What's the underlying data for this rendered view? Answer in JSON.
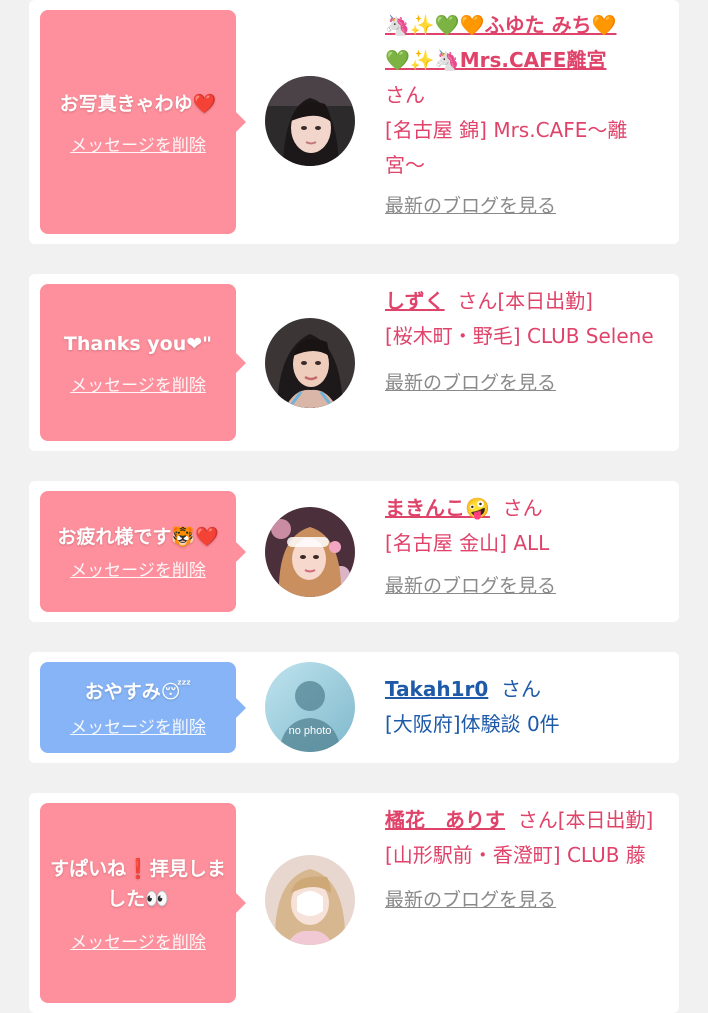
{
  "messages": [
    {
      "message": "お写真きゃわゆ❤️",
      "delete_label": "メッセージを削除",
      "name_line1": "🦄✨💚🧡ふゆた みち🧡",
      "name_line2": "💚✨🦄Mrs.CAFE離宮",
      "san": "さん",
      "shop": "[名古屋 錦] Mrs.CAFE〜離宮〜",
      "blog_label": "最新のブログを見る"
    },
    {
      "message": "Thanks you❤\"",
      "delete_label": "メッセージを削除",
      "name": "しずく",
      "san": "さん[本日出勤]",
      "shop": "[桜木町・野毛] CLUB Selene",
      "blog_label": "最新のブログを見る"
    },
    {
      "message": "お疲れ様です🐯❤️",
      "delete_label": "メッセージを削除",
      "name": "まきんこ🤪",
      "san": "さん",
      "shop": "[名古屋 金山] ALL",
      "blog_label": "最新のブログを見る"
    },
    {
      "message": "おやすみ😴",
      "delete_label": "メッセージを削除",
      "avatar_text": "no photo",
      "name": "Takah1r0",
      "san": "さん",
      "shop": "[大阪府]体験談 0件"
    },
    {
      "message": "すぱいね❗️拝見しました👀",
      "delete_label": "メッセージを削除",
      "name": "橘花　ありす",
      "san": "さん[本日出勤]",
      "shop": "[山形駅前・香澄町] CLUB 藤",
      "blog_label": "最新のブログを見る"
    }
  ],
  "colors": {
    "bubble_pink": "#fe8f9c",
    "bubble_blue": "#86b4f6",
    "name_pink": "#e0436a",
    "name_blue": "#1e5aa8"
  }
}
